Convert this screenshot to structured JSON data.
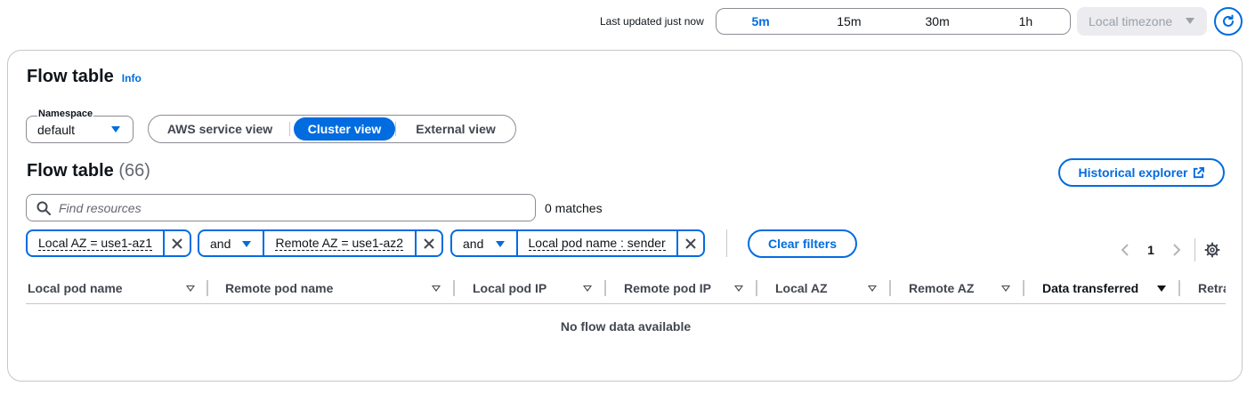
{
  "topbar": {
    "last_updated": "Last updated just now",
    "ranges": [
      "5m",
      "15m",
      "30m",
      "1h"
    ],
    "active_range": "5m",
    "timezone": "Local timezone"
  },
  "panel": {
    "title": "Flow table",
    "info": "Info",
    "namespace": {
      "label": "Namespace",
      "value": "default"
    },
    "views": [
      "AWS service view",
      "Cluster view",
      "External view"
    ],
    "active_view": "Cluster view",
    "table_title": "Flow table",
    "table_count": "(66)",
    "historical_button": "Historical explorer",
    "search_placeholder": "Find resources",
    "matches": "0 matches",
    "filters": [
      {
        "operator": "",
        "text": "Local AZ = use1-az1"
      },
      {
        "operator": "and",
        "text": "Remote AZ = use1-az2"
      },
      {
        "operator": "and",
        "text": "Local pod name : sender"
      }
    ],
    "clear_filters": "Clear filters",
    "page": "1",
    "columns": [
      "Local pod name",
      "Remote pod name",
      "Local pod IP",
      "Remote pod IP",
      "Local AZ",
      "Remote AZ",
      "Data transferred",
      "Retra"
    ],
    "sorted_column": "Data transferred",
    "empty_text": "No flow data available"
  },
  "colors": {
    "accent": "#006ce0",
    "border": "#8c8c94",
    "text": "#0f141a"
  }
}
